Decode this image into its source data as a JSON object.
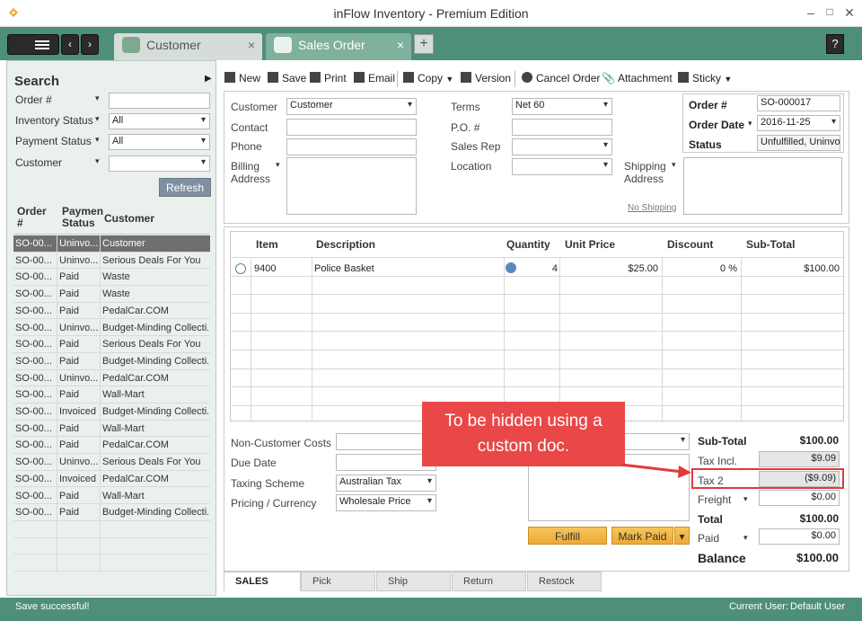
{
  "window": {
    "title": "inFlow Inventory - Premium Edition",
    "help_label": "?"
  },
  "tabs": [
    {
      "label": "Customer",
      "close": "×"
    },
    {
      "label": "Sales Order",
      "close": "×"
    }
  ],
  "new_tab_label": "+",
  "search": {
    "title": "Search",
    "fields": [
      {
        "label": "Order #",
        "value": ""
      },
      {
        "label": "Inventory Status",
        "value": "All"
      },
      {
        "label": "Payment Status",
        "value": "All"
      },
      {
        "label": "Customer",
        "value": ""
      }
    ],
    "refresh_label": "Refresh"
  },
  "results": {
    "columns": [
      "Order\n#",
      "Paymen\nStatus",
      "Customer"
    ],
    "col_order": "Order",
    "col_order2": "#",
    "col_pay": "Paymen",
    "col_pay2": "Status",
    "col_cust": "Customer",
    "rows": [
      [
        "SO-00...",
        "Uninvo...",
        "Customer"
      ],
      [
        "SO-00...",
        "Uninvo...",
        "Serious Deals For You"
      ],
      [
        "SO-00...",
        "Paid",
        "Waste"
      ],
      [
        "SO-00...",
        "Paid",
        "Waste"
      ],
      [
        "SO-00...",
        "Paid",
        "PedalCar.COM"
      ],
      [
        "SO-00...",
        "Uninvo...",
        "Budget-Minding Collecti..."
      ],
      [
        "SO-00...",
        "Paid",
        "Serious Deals For You"
      ],
      [
        "SO-00...",
        "Paid",
        "Budget-Minding Collecti..."
      ],
      [
        "SO-00...",
        "Uninvo...",
        "PedalCar.COM"
      ],
      [
        "SO-00...",
        "Paid",
        "Wall-Mart"
      ],
      [
        "SO-00...",
        "Invoiced",
        "Budget-Minding Collecti..."
      ],
      [
        "SO-00...",
        "Paid",
        "Wall-Mart"
      ],
      [
        "SO-00...",
        "Paid",
        "PedalCar.COM"
      ],
      [
        "SO-00...",
        "Uninvo...",
        "Serious Deals For You"
      ],
      [
        "SO-00...",
        "Invoiced",
        "PedalCar.COM"
      ],
      [
        "SO-00...",
        "Paid",
        "Wall-Mart"
      ],
      [
        "SO-00...",
        "Paid",
        "Budget-Minding Collecti..."
      ]
    ]
  },
  "toolbar": {
    "new": "New",
    "save": "Save",
    "print": "Print",
    "email": "Email",
    "copy": "Copy",
    "version": "Version",
    "cancel_order": "Cancel Order",
    "attachment": "Attachment",
    "sticky": "Sticky"
  },
  "header_form": {
    "customer_label": "Customer",
    "customer_value": "Customer",
    "contact_label": "Contact",
    "phone_label": "Phone",
    "billing_label": "Billing",
    "billing_label2": "Address",
    "terms_label": "Terms",
    "terms_value": "Net 60",
    "po_label": "P.O. #",
    "sales_rep_label": "Sales Rep",
    "location_label": "Location",
    "shipping_label": "Shipping",
    "shipping_label2": "Address",
    "no_shipping": "No Shipping",
    "order_no_label": "Order #",
    "order_no_value": "SO-000017",
    "order_date_label": "Order Date",
    "order_date_value": "2016-11-25",
    "status_label": "Status",
    "status_value": "Unfulfilled, Uninvoic"
  },
  "items": {
    "columns": {
      "item": "Item",
      "description": "Description",
      "quantity": "Quantity",
      "unit_price": "Unit Price",
      "discount": "Discount",
      "subtotal": "Sub-Total"
    },
    "rows": [
      {
        "item": "9400",
        "description": "Police Basket",
        "quantity": "4",
        "unit_price": "$25.00",
        "discount": "0 %",
        "subtotal": "$100.00"
      }
    ]
  },
  "footer_form": {
    "non_customer_costs": "Non-Customer Costs",
    "due_date": "Due Date",
    "taxing_scheme_label": "Taxing Scheme",
    "taxing_scheme_value": "Australian Tax",
    "pricing_label": "Pricing / Currency",
    "pricing_value": "Wholesale Price"
  },
  "totals": {
    "subtotal_label": "Sub-Total",
    "subtotal_value": "$100.00",
    "tax_incl_label": "Tax Incl.",
    "tax_incl_value": "$9.09",
    "tax2_label": "Tax 2",
    "tax2_value": "($9.09)",
    "freight_label": "Freight",
    "freight_value": "$0.00",
    "total_label": "Total",
    "total_value": "$100.00",
    "paid_label": "Paid",
    "paid_value": "$0.00",
    "balance_label": "Balance",
    "balance_value": "$100.00"
  },
  "actions": {
    "fulfill": "Fulfill",
    "mark_paid": "Mark Paid"
  },
  "bottom_tabs": [
    "SALES",
    "Pick",
    "Ship",
    "Return",
    "Restock"
  ],
  "status_bar": {
    "message": "Save successful!",
    "current_user_label": "Current User:",
    "current_user": "Default User"
  },
  "callout": {
    "line1": "To be hidden using a",
    "line2": "custom doc."
  },
  "colors": {
    "accent": "#4e8f7c",
    "callout": "#ea4748",
    "button": "#eeaa35"
  }
}
